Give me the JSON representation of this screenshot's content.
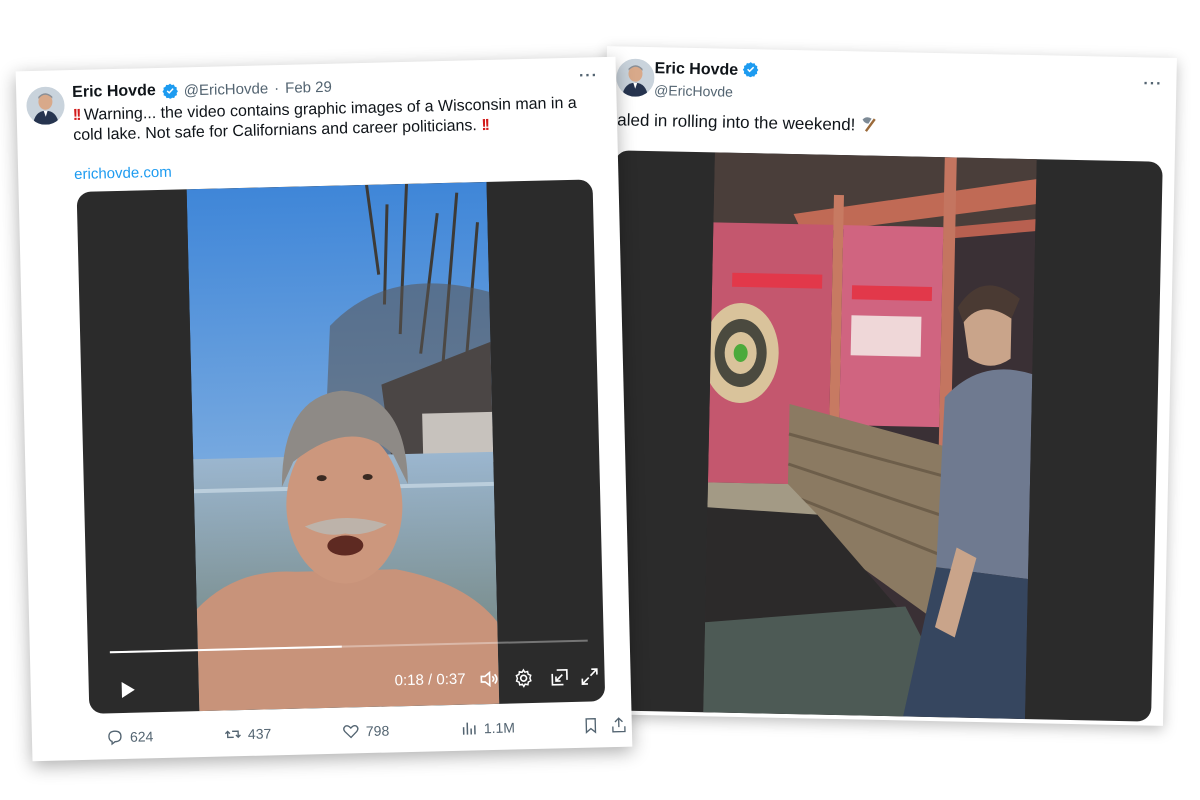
{
  "tweets": [
    {
      "author": "Eric Hovde",
      "handle": "@EricHovde",
      "separator": "·",
      "date": "Feb 29",
      "text": "Warning... the video contains graphic images of a Wisconsin man in a cold lake. Not safe for Californians and career politicians.",
      "link": "erichovde.com",
      "video": {
        "elapsed": "0:18",
        "duration": "0:37",
        "time_separator": "/",
        "progress": 0.486
      },
      "metrics": {
        "replies": "624",
        "reposts": "437",
        "likes": "798",
        "views": "1.1M"
      }
    },
    {
      "author": "Eric Hovde",
      "handle": "@EricHovde",
      "text": "ialed in rolling into the weekend!"
    }
  ],
  "icons": {
    "verified": "verified-badge-icon",
    "more": "more-dots-icon",
    "warning": "double-exclamation-icon",
    "axe": "axe-emoji-icon",
    "play": "play-icon",
    "volume": "volume-icon",
    "settings": "gear-icon",
    "pip": "picture-in-picture-icon",
    "fullscreen": "fullscreen-icon",
    "reply": "reply-icon",
    "repost": "repost-icon",
    "like": "heart-icon",
    "views": "views-chart-icon",
    "bookmark": "bookmark-icon",
    "share": "share-icon"
  },
  "colors": {
    "link": "#1d9bf0",
    "verified": "#1d9bf0",
    "warning": "#d21b1b",
    "muted": "#536471"
  }
}
